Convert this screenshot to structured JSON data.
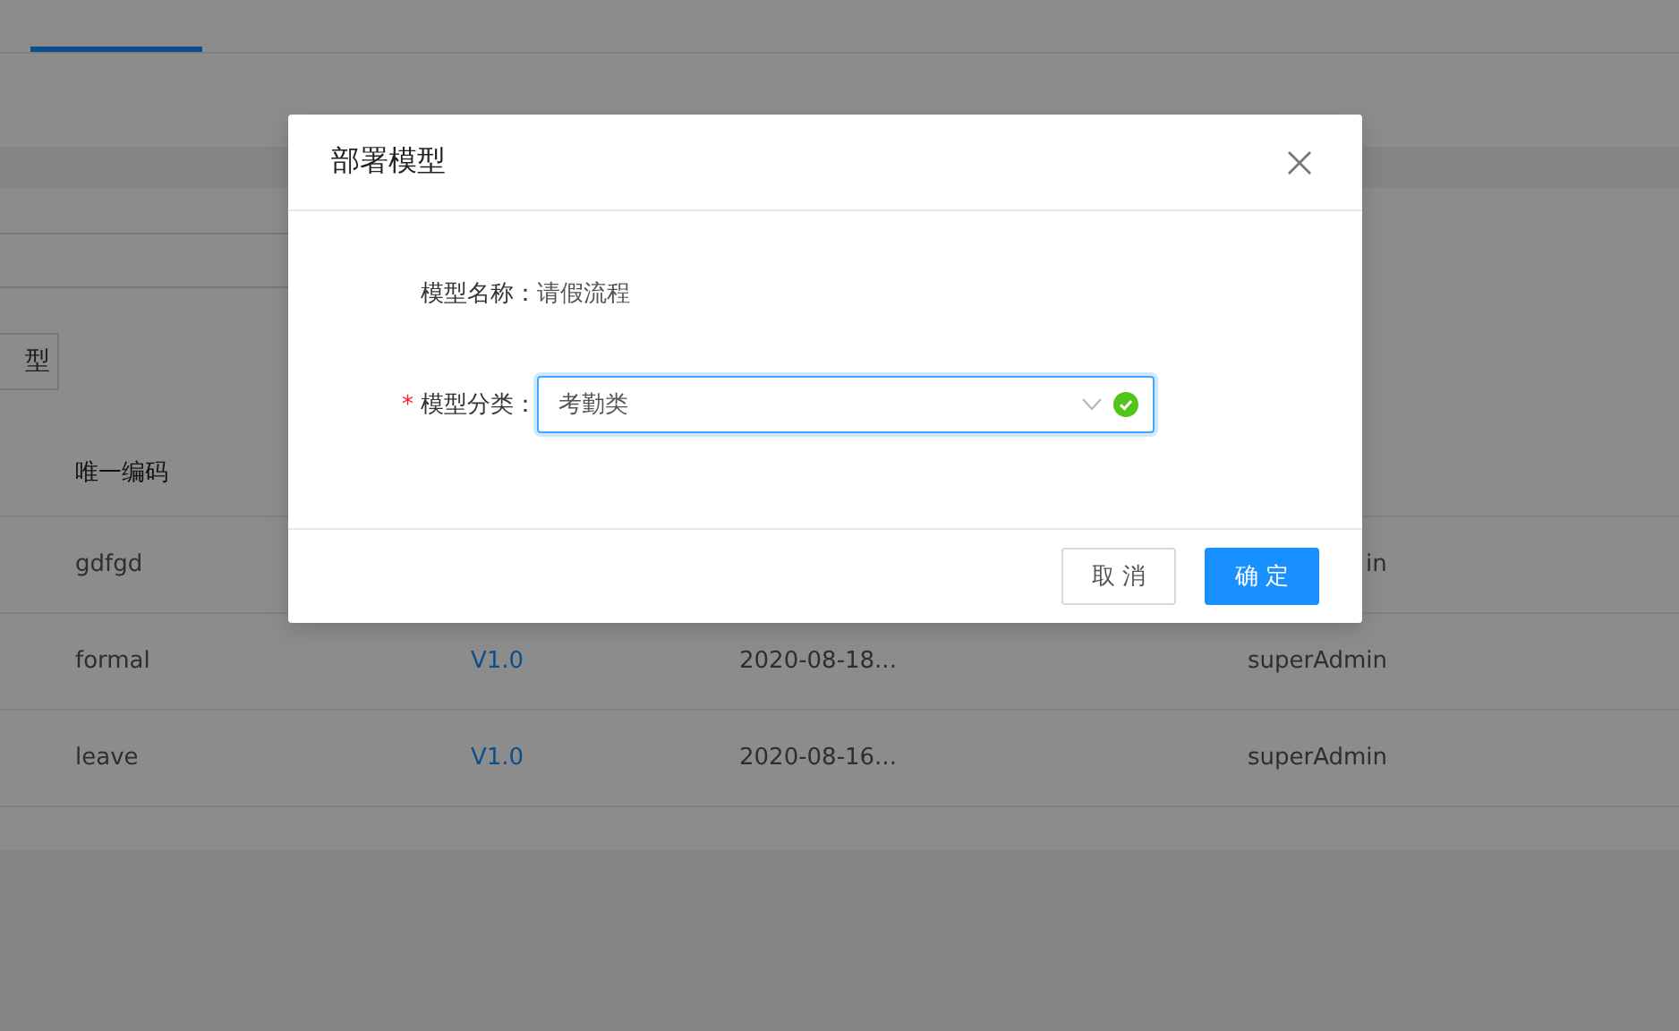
{
  "background_page": {
    "tabs": [
      {
        "selected": true
      }
    ],
    "button": {
      "label": "型"
    },
    "table": {
      "columns": [
        "唯一编码"
      ],
      "rows": [
        {
          "cells": [
            "gdfgd",
            "",
            "",
            "in"
          ],
          "covered_by_dialog": true
        },
        {
          "cells": [
            "formal",
            "V1.0",
            "2020-08-18...",
            "superAdmin"
          ],
          "covered_by_dialog": false
        },
        {
          "cells": [
            "leave",
            "V1.0",
            "2020-08-16...",
            "superAdmin"
          ],
          "covered_by_dialog": false
        }
      ]
    }
  },
  "dialog": {
    "title": "部署模型",
    "fields": [
      {
        "kind": "text",
        "label": "模型名称：",
        "value": "请假流程"
      },
      {
        "kind": "select",
        "label": "模型分类：",
        "marker": "*",
        "value": "考勤类",
        "valid": true,
        "focused": true
      }
    ],
    "buttons": [
      {
        "label": "取 消",
        "primary": false
      },
      {
        "label": "确 定",
        "primary": true
      }
    ]
  }
}
